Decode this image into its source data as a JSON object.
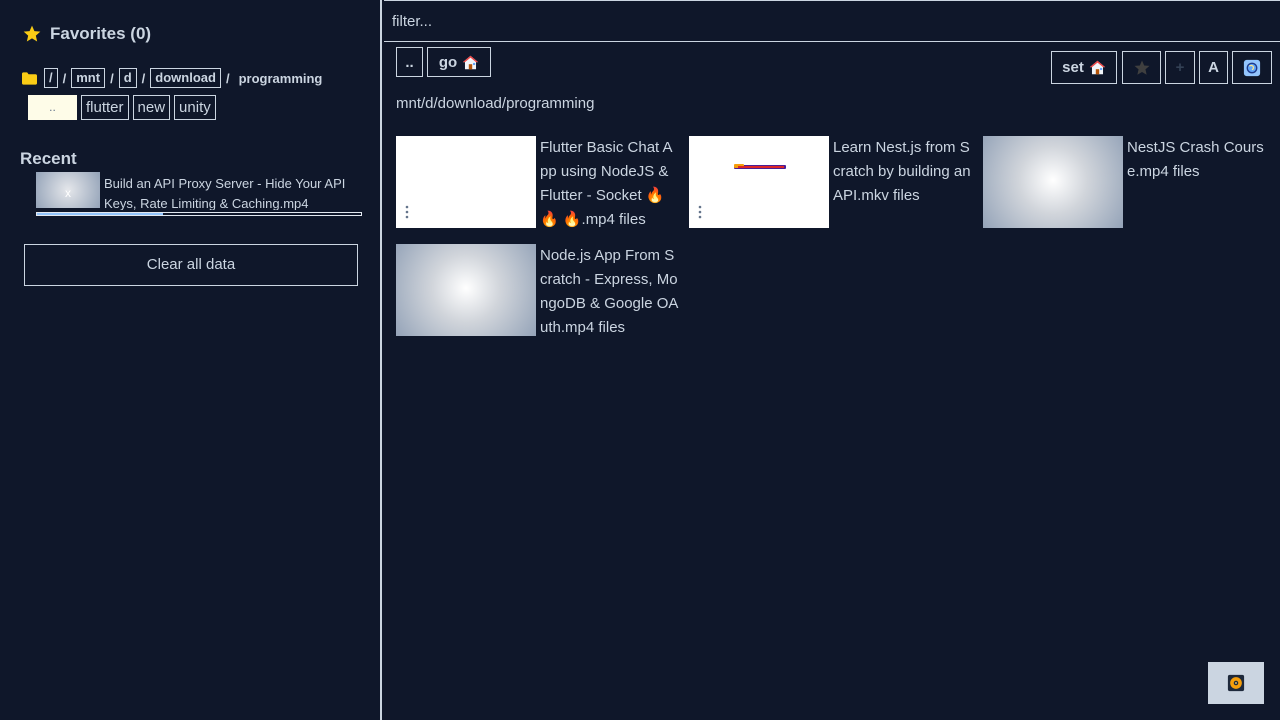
{
  "favorites": {
    "title": "Favorites (0)"
  },
  "breadcrumb": {
    "root": "/",
    "segments": [
      "mnt",
      "d",
      "download"
    ],
    "current": "programming"
  },
  "subdirs": [
    "..",
    "flutter",
    "new",
    "unity"
  ],
  "recent": {
    "title": "Recent",
    "thumb_label": "x",
    "item_title": "Build an API Proxy Server - Hide Your API Keys, Rate Limiting & Caching.mp4",
    "progress": 0.39
  },
  "clear_label": "Clear all data",
  "filter": {
    "placeholder": "filter..."
  },
  "nav": {
    "up_label": "..",
    "go_label": "go"
  },
  "tools": {
    "set_label": "set",
    "font_label": "A",
    "plus_label": "+"
  },
  "path": "mnt/d/download/programming",
  "files": [
    {
      "title": "Flutter Basic Chat App using NodeJS & Flutter - Socket 🔥 🔥 🔥.mp4 files",
      "thumb": "white"
    },
    {
      "title": "Learn Nest.js from Scratch by building an API.mkv files",
      "thumb": "white-bar"
    },
    {
      "title": "NestJS Crash Course.mp4 files",
      "thumb": "gray"
    },
    {
      "title": "Node.js App From Scratch - Express, MongoDB & Google OAuth.mp4 files",
      "thumb": "gray"
    }
  ],
  "colors": {
    "background": "#0f172a",
    "text": "#cbd5e1",
    "star": "#facc15",
    "folder": "#facc15",
    "progress": "#93c5fd"
  }
}
